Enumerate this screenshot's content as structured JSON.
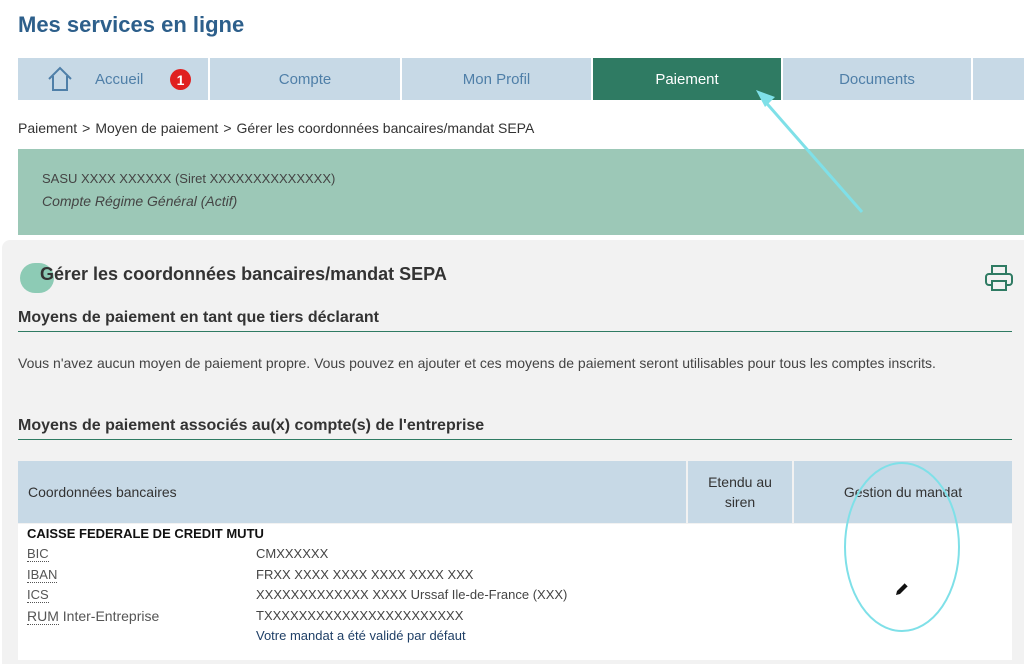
{
  "page_title": "Mes services en ligne",
  "nav": {
    "items": [
      {
        "label": "Accueil",
        "badge": "1",
        "icon": "home-icon"
      },
      {
        "label": "Compte"
      },
      {
        "label": "Mon Profil"
      },
      {
        "label": "Paiement",
        "active": true
      },
      {
        "label": "Documents"
      }
    ]
  },
  "breadcrumb": {
    "items": [
      "Paiement",
      "Moyen de paiement",
      "Gérer les coordonnées bancaires/mandat SEPA"
    ],
    "separator": ">"
  },
  "account": {
    "company": "SASU XXXX XXXXXX (Siret XXXXXXXXXXXXXX)",
    "regime": "Compte Régime Général (Actif)"
  },
  "section": {
    "title": "Gérer les coordonnées bancaires/mandat SEPA",
    "print_icon": "printer-icon",
    "subsection1_title": "Moyens de paiement en tant que tiers déclarant",
    "subsection1_text": "Vous n'avez aucun moyen de paiement propre. Vous pouvez en ajouter et ces moyens de paiement seront utilisables pour tous les comptes inscrits.",
    "subsection2_title": "Moyens de paiement associés au(x) compte(s) de l'entreprise"
  },
  "table": {
    "headers": {
      "coordonnees": "Coordonnées bancaires",
      "etendu": "Etendu au siren",
      "gestion": "Gestion du mandat"
    },
    "row": {
      "bank_name": "CAISSE FEDERALE DE CREDIT MUTU",
      "bic_label": "BIC",
      "bic_value": "CMXXXXXX",
      "iban_label": "IBAN",
      "iban_value": "FRXX XXXX XXXX XXXX XXXX XXX",
      "ics_label": "ICS",
      "ics_value": "XXXXXXXXXXXXX XXXX Urssaf Ile-de-France (XXX)",
      "rum_label": "RUM",
      "rum_suffix": "Inter-Entreprise",
      "rum_value": "TXXXXXXXXXXXXXXXXXXXXXXX",
      "mandat_note": "Votre mandat a été validé par défaut",
      "edit_icon": "pencil-icon"
    }
  },
  "colors": {
    "brand_blue": "#2d5f8b",
    "nav_bg": "#c7d9e6",
    "nav_active": "#2f7b63",
    "banner": "#9cc8b7",
    "annotation": "#7fe0e8"
  }
}
